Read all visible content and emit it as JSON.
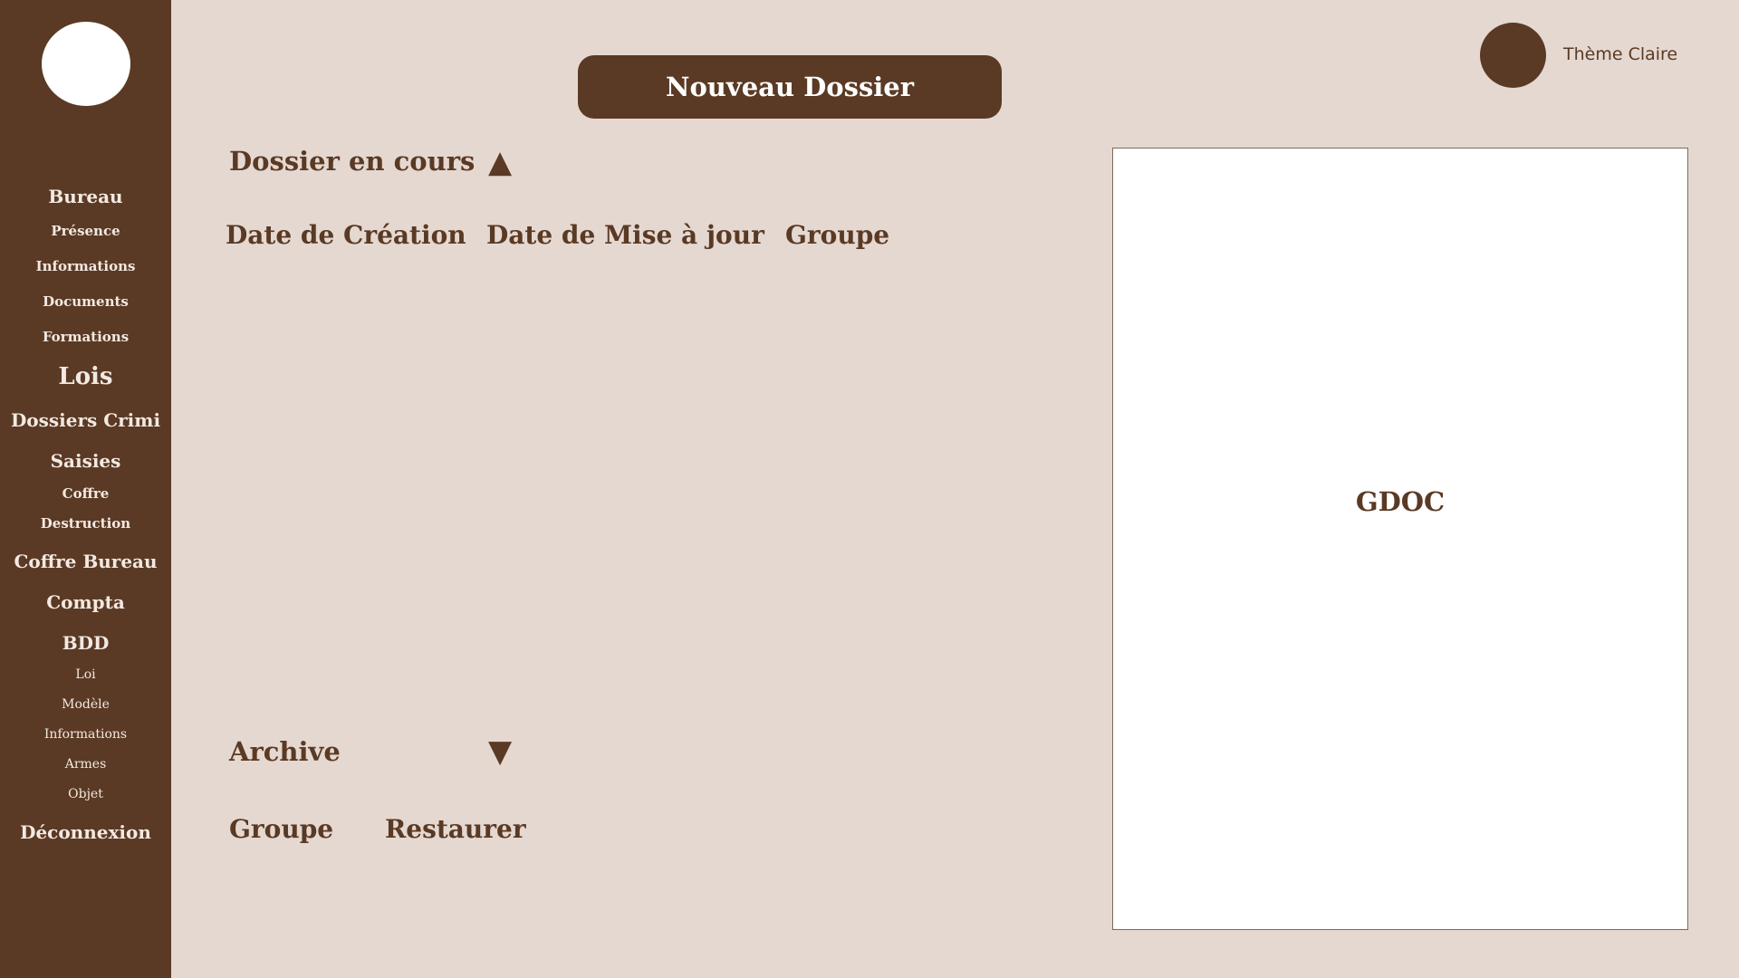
{
  "sidebar": {
    "items": [
      {
        "label": "Bureau"
      },
      {
        "label": "Présence"
      },
      {
        "label": "Informations"
      },
      {
        "label": "Documents"
      },
      {
        "label": "Formations"
      },
      {
        "label": "Lois"
      },
      {
        "label": "Dossiers Crimi"
      },
      {
        "label": "Saisies"
      },
      {
        "label": "Coffre"
      },
      {
        "label": "Destruction"
      },
      {
        "label": "Coffre Bureau"
      },
      {
        "label": "Compta"
      },
      {
        "label": "BDD"
      },
      {
        "label": "Loi"
      },
      {
        "label": "Modèle"
      },
      {
        "label": "Informations"
      },
      {
        "label": "Armes"
      },
      {
        "label": "Objet"
      },
      {
        "label": "Déconnexion"
      }
    ]
  },
  "header": {
    "new_folder_label": "Nouveau Dossier",
    "theme_label": "Thème Claire"
  },
  "current_section": {
    "title": "Dossier en cours",
    "toggle_glyph": "▲",
    "columns": [
      "Date de Création",
      "Date de Mise à jour",
      "Groupe"
    ]
  },
  "archive_section": {
    "title": "Archive",
    "toggle_glyph": "▼",
    "columns": [
      "Groupe",
      "Restaurer"
    ]
  },
  "preview": {
    "label": "GDOC"
  },
  "colors": {
    "background": "#e5d8d1",
    "primary": "#5a3a24",
    "sidebar_text": "#f3e9e2",
    "preview_background": "#ffffff"
  }
}
